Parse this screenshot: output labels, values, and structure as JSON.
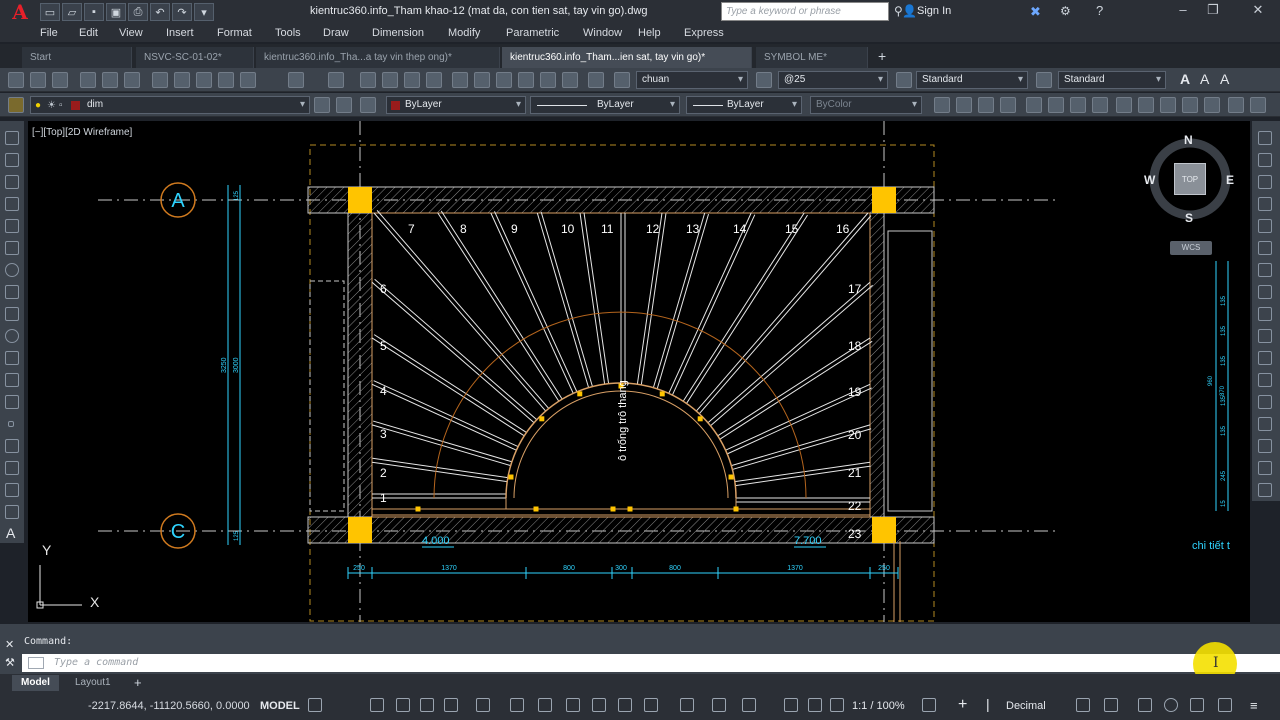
{
  "app": {
    "logo": "A",
    "document_title": "kientruc360.info_Tham khao-12 (mat da, con tien sat, tay vin go).dwg",
    "search_placeholder": "Type a keyword or phrase",
    "sign_in": "Sign In"
  },
  "menu": [
    "File",
    "Edit",
    "View",
    "Insert",
    "Format",
    "Tools",
    "Draw",
    "Dimension",
    "Modify",
    "Parametric",
    "Window",
    "Help",
    "Express"
  ],
  "tabs": [
    {
      "label": "Start",
      "active": false
    },
    {
      "label": "NSVC-SC-01-02*",
      "active": false
    },
    {
      "label": "kientruc360.info_Tha...a tay vin thep ong)*",
      "active": false
    },
    {
      "label": "kientruc360.info_Tham...ien sat, tay vin go)*",
      "active": true
    },
    {
      "label": "SYMBOL ME*",
      "active": false
    }
  ],
  "toolbar1": {
    "text_style": "chuan",
    "dim_style": "@25",
    "table_style": "Standard",
    "multileader_style": "Standard"
  },
  "toolbar2": {
    "layer": "dim",
    "color": "ByLayer",
    "linetype": "ByLayer",
    "lineweight": "ByLayer",
    "plotstyle": "ByColor"
  },
  "viewport": {
    "label": "[−][Top][2D Wireframe]",
    "viewcube": {
      "top": "TOP",
      "n": "N",
      "s": "S",
      "e": "E",
      "w": "W",
      "wcs": "WCS"
    }
  },
  "drawing": {
    "grid_labels": [
      "A",
      "C"
    ],
    "step_numbers_top": [
      "7",
      "8",
      "9",
      "10",
      "11",
      "12",
      "13",
      "14",
      "15",
      "16"
    ],
    "step_numbers_left": [
      "6",
      "5",
      "4",
      "3",
      "2",
      "1"
    ],
    "step_numbers_right": [
      "17",
      "18",
      "19",
      "20",
      "21",
      "22",
      "23"
    ],
    "center_note": "ô trống trô thang",
    "levels": [
      "4.000",
      "7.700"
    ],
    "dims_bottom": [
      "250",
      "1370",
      "800",
      "300",
      "800",
      "1370",
      "250"
    ],
    "dims_left": [
      "3250",
      "3000",
      "125",
      "125"
    ],
    "dims_right": [
      "960",
      "870",
      "135",
      "135",
      "135",
      "135",
      "135",
      "245",
      "15"
    ],
    "right_note": "chi tiết t"
  },
  "command": {
    "label": "Command:",
    "placeholder": "Type a command"
  },
  "layout_tabs": [
    {
      "label": "Model",
      "active": true
    },
    {
      "label": "Layout1",
      "active": false
    }
  ],
  "status": {
    "coords": "-2217.8644, -11120.5660, 0.0000",
    "space": "MODEL",
    "scale": "1:1 / 100%",
    "units": "Decimal"
  }
}
